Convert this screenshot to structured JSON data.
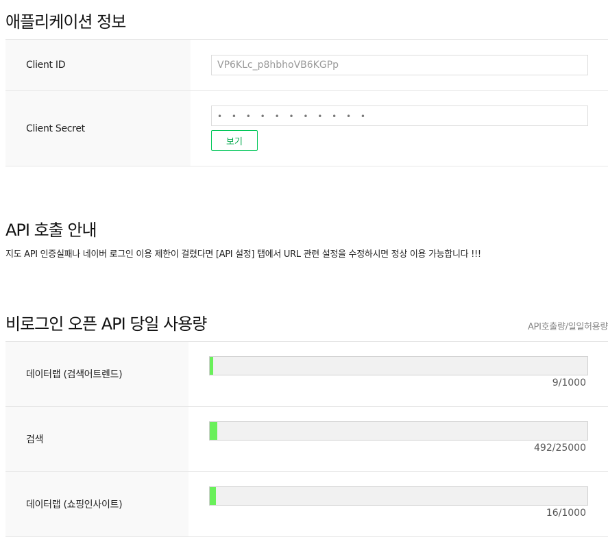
{
  "app_info": {
    "title": "애플리케이션 정보",
    "client_id_label": "Client ID",
    "client_id_value": "VP6KLc_p8hbhoVB6KGPp",
    "client_secret_label": "Client Secret",
    "client_secret_value": "• • • • • • • • • • •",
    "view_button_label": "보기"
  },
  "api_notice": {
    "title": "API 호출 안내",
    "text": "지도 API 인증실패나 네이버 로그인 이용 제한이 걸렸다면 [API 설정] 탭에서 URL 관련 설정을 수정하시면 정상 이용 가능합니다 !!!"
  },
  "usage": {
    "title": "비로그인 오픈 API 당일 사용량",
    "legend": "API호출량/일일허용량",
    "bar_color": "#69f05a",
    "rows": [
      {
        "label": "데이터랩 (검색어트렌드)",
        "used": 9,
        "limit": 1000,
        "text": "9/1000"
      },
      {
        "label": "검색",
        "used": 492,
        "limit": 25000,
        "text": "492/25000"
      },
      {
        "label": "데이터랩 (쇼핑인사이트)",
        "used": 16,
        "limit": 1000,
        "text": "16/1000"
      }
    ]
  }
}
